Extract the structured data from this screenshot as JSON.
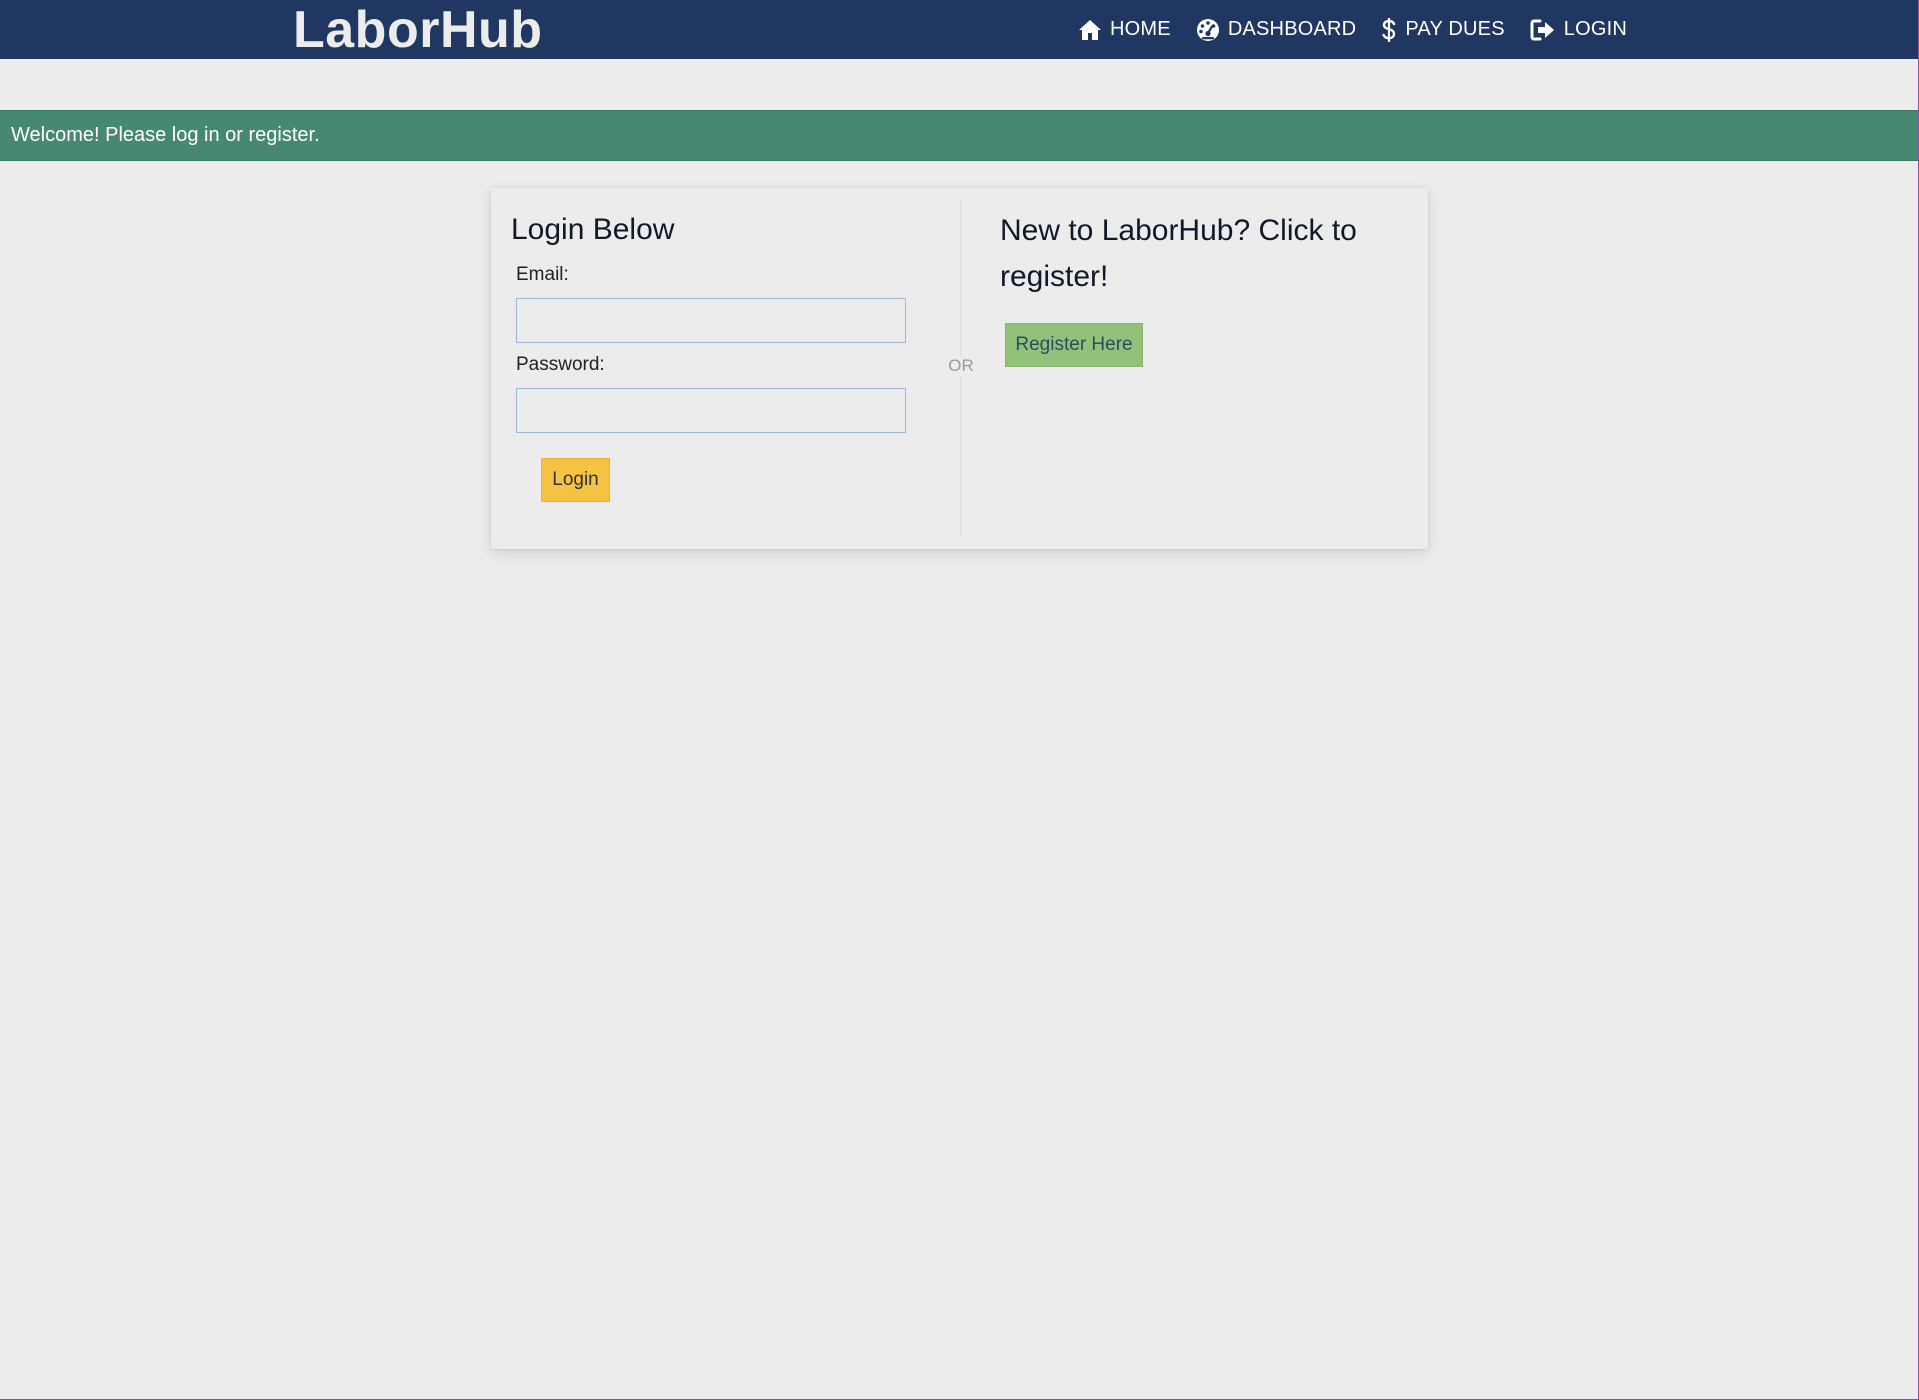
{
  "navbar": {
    "brand": "LaborHub",
    "links": [
      {
        "label": "HOME",
        "icon": "home-icon"
      },
      {
        "label": "DASHBOARD",
        "icon": "dashboard-icon"
      },
      {
        "label": "PAY DUES",
        "icon": "dollar-icon"
      },
      {
        "label": "LOGIN",
        "icon": "login-icon"
      }
    ]
  },
  "flash": {
    "message": "Welcome! Please log in or register."
  },
  "login": {
    "title": "Login Below",
    "email_label": "Email:",
    "email_value": "",
    "password_label": "Password:",
    "password_value": "",
    "submit_label": "Login"
  },
  "divider": {
    "label": "OR"
  },
  "register": {
    "title": "New to LaborHub? Click to register!",
    "button_label": "Register Here"
  },
  "colors": {
    "navbar_bg": "#1f3761",
    "flash_bg": "#478870",
    "login_button": "#f5c242",
    "register_button": "#94c17a",
    "page_bg": "#ececec"
  }
}
